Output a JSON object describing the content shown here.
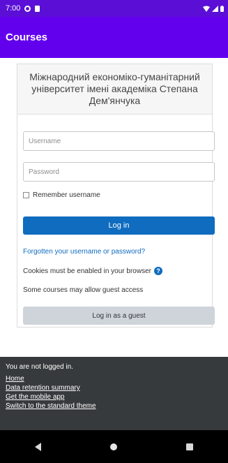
{
  "status_bar": {
    "time": "7:00"
  },
  "app_bar": {
    "title": "Courses"
  },
  "login": {
    "organization": "Міжнародний економіко-гуманітарний університет імені академіка Степана Дем'янчука",
    "username_placeholder": "Username",
    "password_placeholder": "Password",
    "remember_label": "Remember username",
    "login_button": "Log in",
    "forgot_link": "Forgotten your username or password?",
    "cookies_text": "Cookies must be enabled in your browser",
    "guest_note": "Some courses may allow guest access",
    "guest_button": "Log in as a guest"
  },
  "footer": {
    "status": "You are not logged in.",
    "links": [
      "Home",
      "Data retention summary",
      "Get the mobile app",
      "Switch to the standard theme"
    ]
  },
  "colors": {
    "status_bar": "#5b0fd6",
    "app_bar": "#6200ee",
    "primary": "#0f6cbf",
    "footer": "#373a3c"
  }
}
